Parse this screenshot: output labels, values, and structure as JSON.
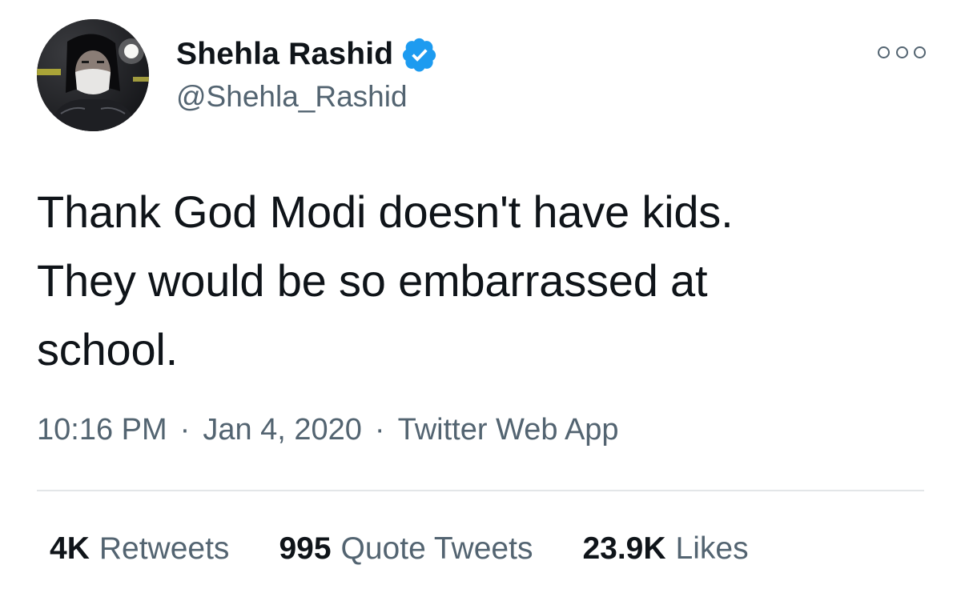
{
  "author": {
    "display_name": "Shehla Rashid",
    "handle": "@Shehla_Rashid",
    "verified": true,
    "avatar": "profile-photo"
  },
  "tweet": {
    "text": "Thank God Modi doesn't have kids.\nThey would be so embarrassed at\nschool.",
    "time": "10:16 PM",
    "date": "Jan 4, 2020",
    "source": "Twitter Web App",
    "separator": "·"
  },
  "stats": {
    "retweets": {
      "count": "4K",
      "label": "Retweets"
    },
    "quote_tweets": {
      "count": "995",
      "label": "Quote Tweets"
    },
    "likes": {
      "count": "23.9K",
      "label": "Likes"
    }
  },
  "icons": {
    "verified": "verified-badge-icon",
    "more": "more-options-icon"
  },
  "colors": {
    "text_primary": "#0f1419",
    "text_secondary": "#536471",
    "verified_blue": "#1d9bf0",
    "divider": "#e3e6e8"
  }
}
